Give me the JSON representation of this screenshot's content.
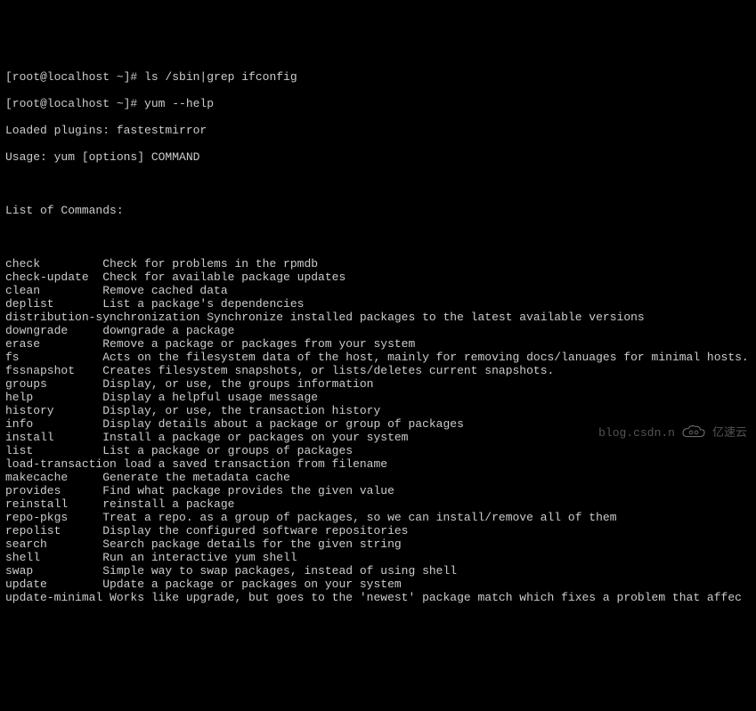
{
  "prompt1": "[root@localhost ~]# ls /sbin|grep ifconfig",
  "prompt2": "[root@localhost ~]# yum --help",
  "loaded": "Loaded plugins: fastestmirror",
  "usage": "Usage: yum [options] COMMAND",
  "list_header": "List of Commands:",
  "commands": [
    {
      "name": "check",
      "desc": "Check for problems in the rpmdb"
    },
    {
      "name": "check-update",
      "desc": "Check for available package updates"
    },
    {
      "name": "clean",
      "desc": "Remove cached data"
    },
    {
      "name": "deplist",
      "desc": "List a package's dependencies"
    },
    {
      "name": "distribution-synchronization",
      "desc": "Synchronize installed packages to the latest available versions",
      "nospace": true
    },
    {
      "name": "downgrade",
      "desc": "downgrade a package"
    },
    {
      "name": "erase",
      "desc": "Remove a package or packages from your system"
    },
    {
      "name": "fs",
      "desc": "Acts on the filesystem data of the host, mainly for removing docs/lanuages for minimal hosts."
    },
    {
      "name": "fssnapshot",
      "desc": "Creates filesystem snapshots, or lists/deletes current snapshots."
    },
    {
      "name": "groups",
      "desc": "Display, or use, the groups information"
    },
    {
      "name": "help",
      "desc": "Display a helpful usage message"
    },
    {
      "name": "history",
      "desc": "Display, or use, the transaction history"
    },
    {
      "name": "info",
      "desc": "Display details about a package or group of packages"
    },
    {
      "name": "install",
      "desc": "Install a package or packages on your system"
    },
    {
      "name": "list",
      "desc": "List a package or groups of packages"
    },
    {
      "name": "load-transaction",
      "desc": "load a saved transaction from filename",
      "nospace": true
    },
    {
      "name": "makecache",
      "desc": "Generate the metadata cache"
    },
    {
      "name": "provides",
      "desc": "Find what package provides the given value"
    },
    {
      "name": "reinstall",
      "desc": "reinstall a package"
    },
    {
      "name": "repo-pkgs",
      "desc": "Treat a repo. as a group of packages, so we can install/remove all of them"
    },
    {
      "name": "repolist",
      "desc": "Display the configured software repositories"
    },
    {
      "name": "search",
      "desc": "Search package details for the given string"
    },
    {
      "name": "shell",
      "desc": "Run an interactive yum shell"
    },
    {
      "name": "swap",
      "desc": "Simple way to swap packages, instead of using shell"
    },
    {
      "name": "update",
      "desc": "Update a package or packages on your system"
    },
    {
      "name": "update-minimal",
      "desc": "Works like upgrade, but goes to the 'newest' package match which fixes a problem that affec",
      "nospace": true
    }
  ],
  "watermark": {
    "text1": "blog.csdn.n",
    "brand": "亿速云"
  }
}
